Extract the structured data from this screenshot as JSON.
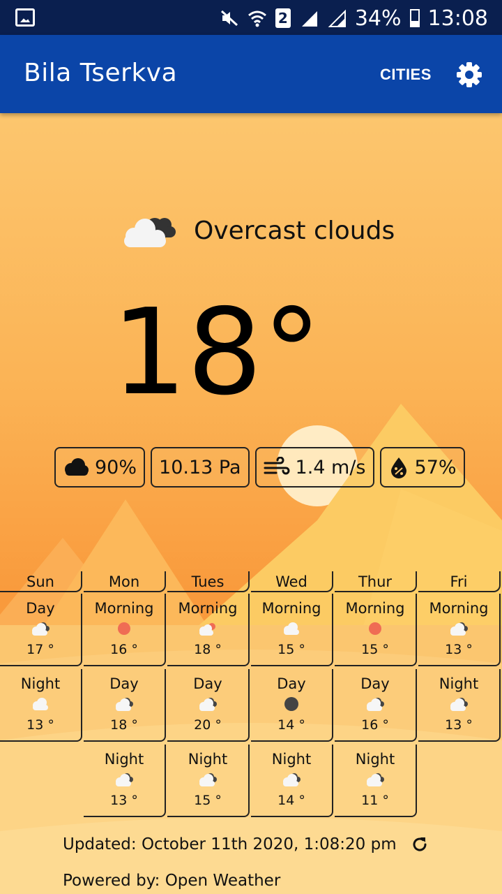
{
  "status_bar": {
    "battery": "34%",
    "time": "13:08",
    "sim": "2"
  },
  "app_bar": {
    "title": "Bila Tserkva",
    "cities_label": "CITIES",
    "settings_icon": "gear-icon"
  },
  "current": {
    "condition": "Overcast clouds",
    "condition_icon": "overcast-clouds-icon",
    "temperature": "18°",
    "cloudiness": "90%",
    "pressure": "10.13 Pa",
    "wind": "1.4 m/s",
    "humidity": "57%"
  },
  "forecast": [
    {
      "day": "Sun",
      "periods": [
        {
          "part": "Day",
          "icon": "cloudy-icon",
          "temp": "17 °"
        },
        {
          "part": "Night",
          "icon": "cloud-icon",
          "temp": "13 °"
        }
      ]
    },
    {
      "day": "Mon",
      "periods": [
        {
          "part": "Morning",
          "icon": "sun-icon",
          "temp": "16 °"
        },
        {
          "part": "Day",
          "icon": "cloudy-icon",
          "temp": "18 °"
        },
        {
          "part": "Night",
          "icon": "cloudy-icon",
          "temp": "13 °"
        }
      ]
    },
    {
      "day": "Tues",
      "periods": [
        {
          "part": "Morning",
          "icon": "sun-cloud-icon",
          "temp": "18 °"
        },
        {
          "part": "Day",
          "icon": "cloudy-icon",
          "temp": "20 °"
        },
        {
          "part": "Night",
          "icon": "cloudy-icon",
          "temp": "15 °"
        }
      ]
    },
    {
      "day": "Wed",
      "periods": [
        {
          "part": "Morning",
          "icon": "cloud-icon",
          "temp": "15 °"
        },
        {
          "part": "Day",
          "icon": "dark-circle-icon",
          "temp": "14 °"
        },
        {
          "part": "Night",
          "icon": "cloudy-icon",
          "temp": "14 °"
        }
      ]
    },
    {
      "day": "Thur",
      "periods": [
        {
          "part": "Morning",
          "icon": "sun-icon",
          "temp": "15 °"
        },
        {
          "part": "Day",
          "icon": "cloudy-icon",
          "temp": "16 °"
        },
        {
          "part": "Night",
          "icon": "cloudy-icon",
          "temp": "11 °"
        }
      ]
    },
    {
      "day": "Fri",
      "periods": [
        {
          "part": "Morning",
          "icon": "cloudy-icon",
          "temp": "13 °"
        },
        {
          "part": "Night",
          "icon": "cloudy-icon",
          "temp": "13 °"
        }
      ]
    }
  ],
  "footer": {
    "updated": "Updated: October 11th 2020, 1:08:20 pm",
    "powered": "Powered by: Open Weather"
  },
  "colors": {
    "app_bar": "#0b45a8",
    "status_bar": "#0a1f4f",
    "sky_top": "#fcc66e",
    "sky_mid": "#fa9e3c",
    "sun": "#fff1cf"
  }
}
